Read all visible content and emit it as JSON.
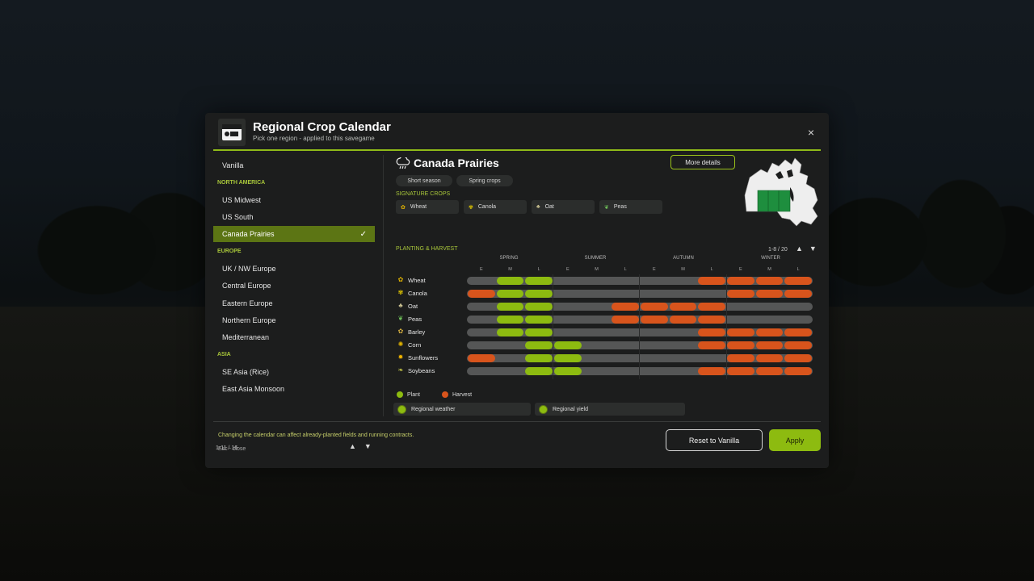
{
  "header": {
    "title": "Regional Crop Calendar",
    "subtitle": "Pick one region - applied to this savegame",
    "close_label": "×"
  },
  "sidebar": {
    "items": [
      {
        "kind": "item",
        "label": "Vanilla"
      },
      {
        "kind": "section",
        "label": "NORTH AMERICA"
      },
      {
        "kind": "item",
        "label": "US Midwest"
      },
      {
        "kind": "item",
        "label": "US South"
      },
      {
        "kind": "item",
        "label": "Canada Prairies",
        "selected": true
      },
      {
        "kind": "section",
        "label": "EUROPE"
      },
      {
        "kind": "item",
        "label": "UK / NW Europe"
      },
      {
        "kind": "item",
        "label": "Central Europe"
      },
      {
        "kind": "item",
        "label": "Eastern Europe"
      },
      {
        "kind": "item",
        "label": "Northern Europe"
      },
      {
        "kind": "item",
        "label": "Mediterranean"
      },
      {
        "kind": "section",
        "label": "ASIA"
      },
      {
        "kind": "item",
        "label": "SE Asia (Rice)"
      },
      {
        "kind": "item",
        "label": "East Asia Monsoon"
      }
    ],
    "check": "✓",
    "pager": "1-11 / 16",
    "arrow_up": "▲",
    "arrow_down": "▼"
  },
  "region": {
    "name": "Canada Prairies",
    "tags": [
      "Short season",
      "Spring crops"
    ],
    "more_details": "More details",
    "signature_label": "SIGNATURE CROPS",
    "signature_crops": [
      "Wheat",
      "Canola",
      "Oat",
      "Peas"
    ]
  },
  "calendar": {
    "label": "PLANTING & HARVEST",
    "pager": "1-8 / 20",
    "arrow_up": "▲",
    "arrow_down": "▼",
    "seasons": [
      "SPRING",
      "SUMMER",
      "AUTUMN",
      "WINTER"
    ],
    "subperiods": [
      "E",
      "M",
      "L",
      "E",
      "M",
      "L",
      "E",
      "M",
      "L",
      "E",
      "M",
      "L"
    ],
    "crops": [
      {
        "name": "Wheat",
        "icon": "wheat-icon",
        "glyph": "✿",
        "plant": [
          1,
          2
        ],
        "harvest": [
          8,
          9,
          10,
          11
        ]
      },
      {
        "name": "Canola",
        "icon": "canola-icon",
        "glyph": "✾",
        "plant": [
          1,
          2
        ],
        "harvest": [
          0,
          9,
          10,
          11
        ]
      },
      {
        "name": "Oat",
        "icon": "oat-icon",
        "glyph": "♣",
        "plant": [
          1,
          2
        ],
        "harvest": [
          5,
          6,
          7,
          8
        ]
      },
      {
        "name": "Peas",
        "icon": "peas-icon",
        "glyph": "❦",
        "plant": [
          1,
          2
        ],
        "harvest": [
          5,
          6,
          7,
          8
        ]
      },
      {
        "name": "Barley",
        "icon": "barley-icon",
        "glyph": "✿",
        "plant": [
          1,
          2
        ],
        "harvest": [
          8,
          9,
          10,
          11
        ]
      },
      {
        "name": "Corn",
        "icon": "corn-icon",
        "glyph": "✺",
        "plant": [
          2,
          3
        ],
        "harvest": [
          8,
          9,
          10,
          11
        ]
      },
      {
        "name": "Sunflowers",
        "icon": "sunflower-icon",
        "glyph": "✹",
        "plant": [
          2,
          3
        ],
        "harvest": [
          0,
          9,
          10,
          11
        ]
      },
      {
        "name": "Soybeans",
        "icon": "soybean-icon",
        "glyph": "❧",
        "plant": [
          2,
          3
        ],
        "harvest": [
          8,
          9,
          10,
          11
        ]
      }
    ],
    "legend_plant": "Plant",
    "legend_harvest": "Harvest",
    "toggle_weather": "Regional weather",
    "toggle_yield": "Regional yield"
  },
  "footer": {
    "warning": "Changing the calendar can affect already-planted fields and running contracts.",
    "esc_hint": "Esc - close",
    "reset_label": "Reset to Vanilla",
    "apply_label": "Apply"
  },
  "colors": {
    "accent": "#8dbb10",
    "plant": "#8dbb10",
    "harvest": "#d8541c",
    "track": "#555656",
    "panel": "#1c1d1d"
  }
}
